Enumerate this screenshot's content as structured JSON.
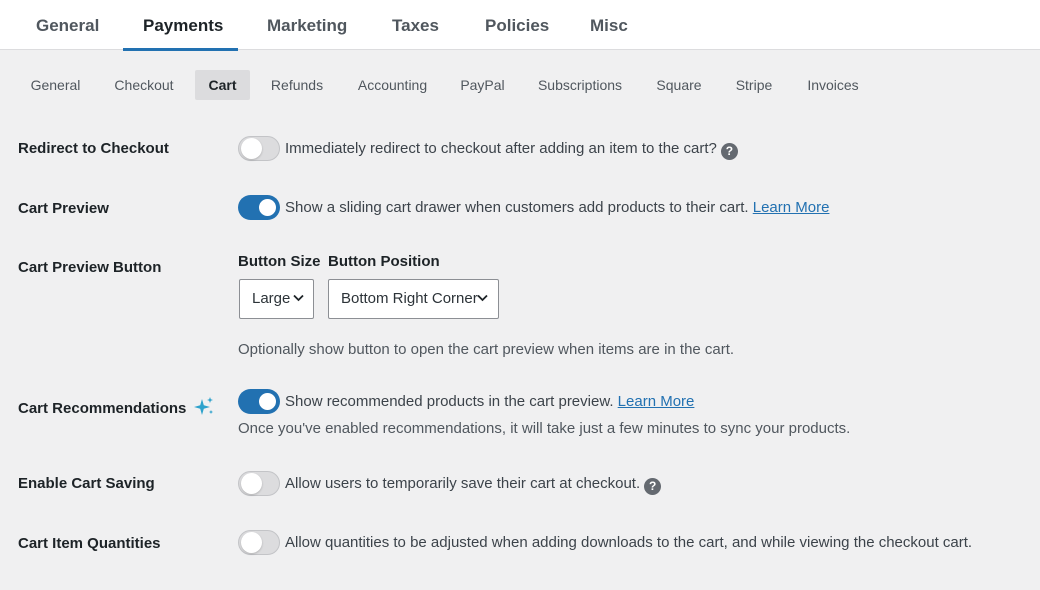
{
  "top_tabs": [
    {
      "label": "General"
    },
    {
      "label": "Payments"
    },
    {
      "label": "Marketing"
    },
    {
      "label": "Taxes"
    },
    {
      "label": "Policies"
    },
    {
      "label": "Misc"
    }
  ],
  "active_top_tab": "Payments",
  "sub_tabs": [
    {
      "label": "General"
    },
    {
      "label": "Checkout"
    },
    {
      "label": "Cart"
    },
    {
      "label": "Refunds"
    },
    {
      "label": "Accounting"
    },
    {
      "label": "PayPal"
    },
    {
      "label": "Subscriptions"
    },
    {
      "label": "Square"
    },
    {
      "label": "Stripe"
    },
    {
      "label": "Invoices"
    }
  ],
  "active_sub_tab": "Cart",
  "settings": {
    "redirect": {
      "label": "Redirect to Checkout",
      "enabled": false,
      "description": "Immediately redirect to checkout after adding an item to the cart?",
      "help_icon": "question-circle-icon"
    },
    "preview": {
      "label": "Cart Preview",
      "enabled": true,
      "description": "Show a sliding cart drawer when customers add products to their cart.",
      "link": "Learn More"
    },
    "preview_button": {
      "label": "Cart Preview Button",
      "size_label": "Button Size",
      "size_value": "Large",
      "position_label": "Button Position",
      "position_value": "Bottom Right Corner",
      "note": "Optionally show button to open the cart preview when items are in the cart."
    },
    "recommendations": {
      "label": "Cart Recommendations",
      "label_icon": "sparkle-icon",
      "enabled": true,
      "description": "Show recommended products in the cart preview.",
      "link": "Learn More",
      "note": "Once you've enabled recommendations, it will take just a few minutes to sync your products."
    },
    "saving": {
      "label": "Enable Cart Saving",
      "enabled": false,
      "description": "Allow users to temporarily save their cart at checkout.",
      "help_icon": "question-circle-icon"
    },
    "quantities": {
      "label": "Cart Item Quantities",
      "enabled": false,
      "description": "Allow quantities to be adjusted when adding downloads to the cart, and while viewing the checkout cart."
    }
  },
  "colors": {
    "accent": "#2271b1",
    "background": "#f0f0f1",
    "sparkle": "#2ea2cc"
  }
}
